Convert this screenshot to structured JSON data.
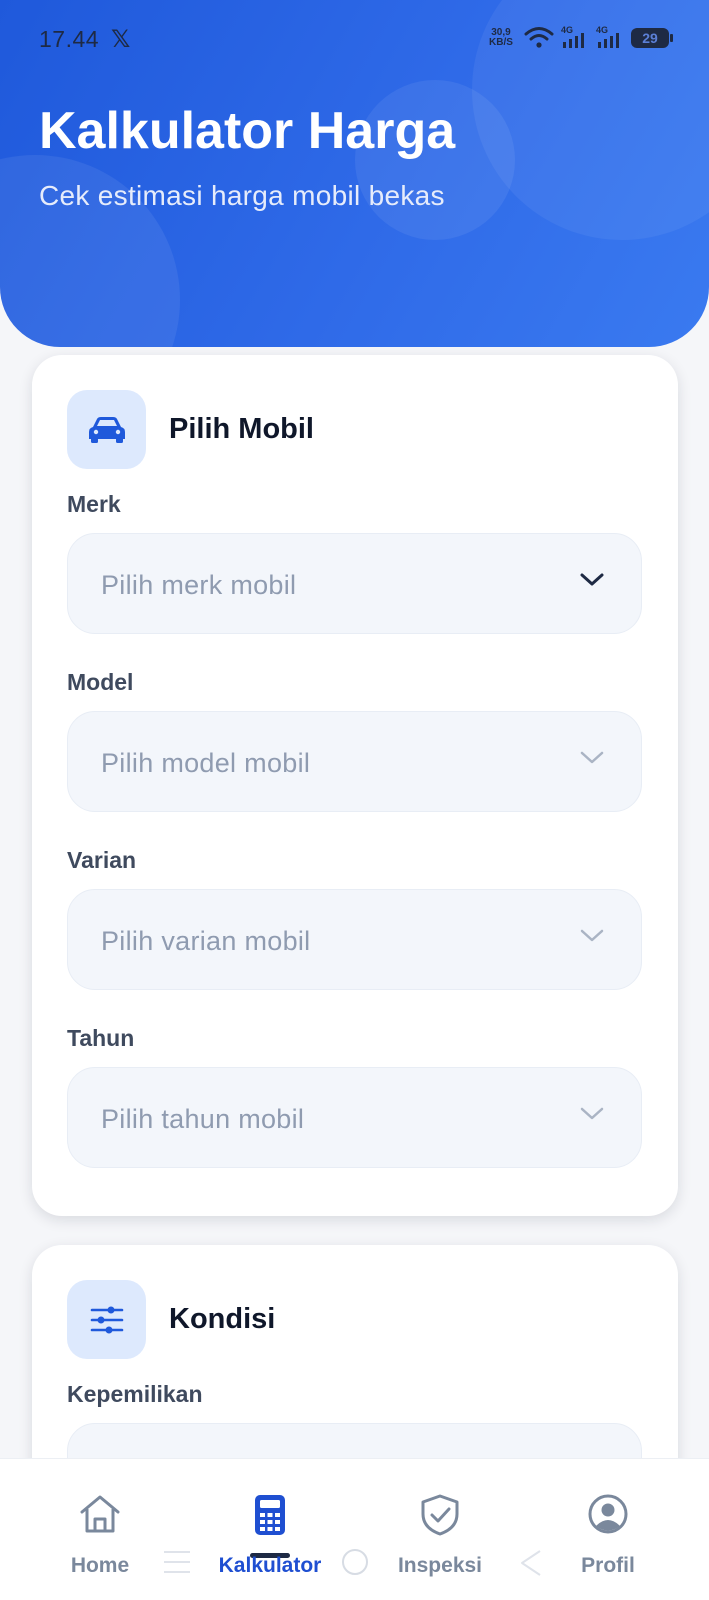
{
  "status_bar": {
    "time": "17.44",
    "net_speed_value": "30,9",
    "net_speed_unit": "KB/S",
    "signal_1_label": "4G",
    "signal_2_label": "4G",
    "battery": "29"
  },
  "header": {
    "title": "Kalkulator Harga",
    "subtitle": "Cek estimasi harga mobil bekas"
  },
  "card_pilih_mobil": {
    "title": "Pilih Mobil",
    "icon": "car-icon",
    "fields": [
      {
        "label": "Merk",
        "placeholder": "Pilih merk mobil",
        "enabled": true
      },
      {
        "label": "Model",
        "placeholder": "Pilih model mobil",
        "enabled": false
      },
      {
        "label": "Varian",
        "placeholder": "Pilih varian mobil",
        "enabled": false
      },
      {
        "label": "Tahun",
        "placeholder": "Pilih tahun mobil",
        "enabled": false
      }
    ]
  },
  "card_kondisi": {
    "title": "Kondisi",
    "icon": "sliders-icon",
    "fields": [
      {
        "label": "Kepemilikan",
        "placeholder": ""
      }
    ]
  },
  "bottom_nav": {
    "items": [
      {
        "label": "Home",
        "icon": "home-icon",
        "active": false
      },
      {
        "label": "Kalkulator",
        "icon": "calculator-icon",
        "active": true
      },
      {
        "label": "Inspeksi",
        "icon": "shield-check-icon",
        "active": false
      },
      {
        "label": "Profil",
        "icon": "profile-icon",
        "active": false
      }
    ]
  },
  "colors": {
    "header_gradient_start": "#1f59db",
    "header_gradient_end": "#3a7af0",
    "accent": "#1f4fd1",
    "icon_box_bg": "#dde9fd",
    "field_bg": "#f3f6fb"
  }
}
